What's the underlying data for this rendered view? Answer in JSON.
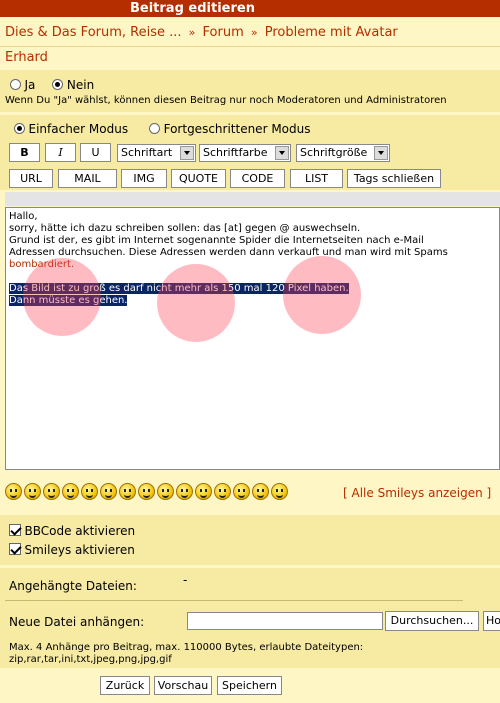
{
  "window": {
    "title": "Beitrag editieren"
  },
  "breadcrumb": {
    "items": [
      "Dies & Das Forum, Reise ...",
      "Forum",
      "Probleme mit Avatar"
    ],
    "separator": "»"
  },
  "user": {
    "name": "Erhard"
  },
  "visibility": {
    "option_yes": "Ja",
    "option_no": "Nein",
    "selected": "Nein",
    "hint": "Wenn Du \"Ja\" wählst, können diesen Beitrag nur noch Moderatoren und Administratoren"
  },
  "mode": {
    "simple": "Einfacher Modus",
    "advanced": "Fortgeschrittener Modus",
    "selected": "Einfacher Modus"
  },
  "format_toolbar": {
    "bold": "B",
    "italic": "I",
    "underline": "U",
    "font": "Schriftart",
    "color": "Schriftfarbe",
    "size": "Schriftgröße"
  },
  "tag_toolbar": {
    "url": "URL",
    "mail": "MAIL",
    "img": "IMG",
    "quote": "QUOTE",
    "code": "CODE",
    "list": "LIST",
    "close_tags": "Tags schließen"
  },
  "message": {
    "line1": "Hallo,",
    "line2": "sorry, hätte ich dazu schreiben sollen:  das [at] gegen @ auswechseln.",
    "line3": "Grund ist der, es gibt im Internet sogenannte Spider die Internetseiten nach e-Mail",
    "line4": "Adressen durchsuchen. Diese Adressen werden dann verkauft und man wird mit Spams",
    "line5": "bombardiert.",
    "line6": "Das Bild ist zu groß es darf nicht mehr als 150 mal 120 Pixel haben.",
    "line7": "Dann müsste es gehen."
  },
  "smileys": {
    "icons": [
      "confused",
      "smile",
      "grin",
      "laugh",
      "happy",
      "sad",
      "angry",
      "eek",
      "frown",
      "cool",
      "rolleyes",
      "wink",
      "tongue",
      "shock",
      "smile2"
    ],
    "show_all": "[ Alle Smileys anzeigen ]"
  },
  "options": {
    "bbcode": "BBCode aktivieren",
    "smileys": "Smileys aktivieren",
    "bbcode_checked": true,
    "smileys_checked": true
  },
  "attachments": {
    "label": "Angehängte Dateien:",
    "value": "-",
    "new_label": "Neue Datei anhängen:",
    "browse": "Durchsuchen...",
    "extra_button": "Ho",
    "info_line1": "Max. 4 Anhänge pro Beitrag, max. 110000 Bytes, erlaubte Dateitypen:",
    "info_line2": "zip,rar,tar,ini,txt,jpeg,png,jpg,gif"
  },
  "actions": {
    "back": "Zurück",
    "preview": "Vorschau",
    "save": "Speichern"
  },
  "colors": {
    "title_bar": "#b52e00",
    "background": "#fff6c6",
    "panel": "#f7eaa3",
    "link": "#b52e00"
  }
}
